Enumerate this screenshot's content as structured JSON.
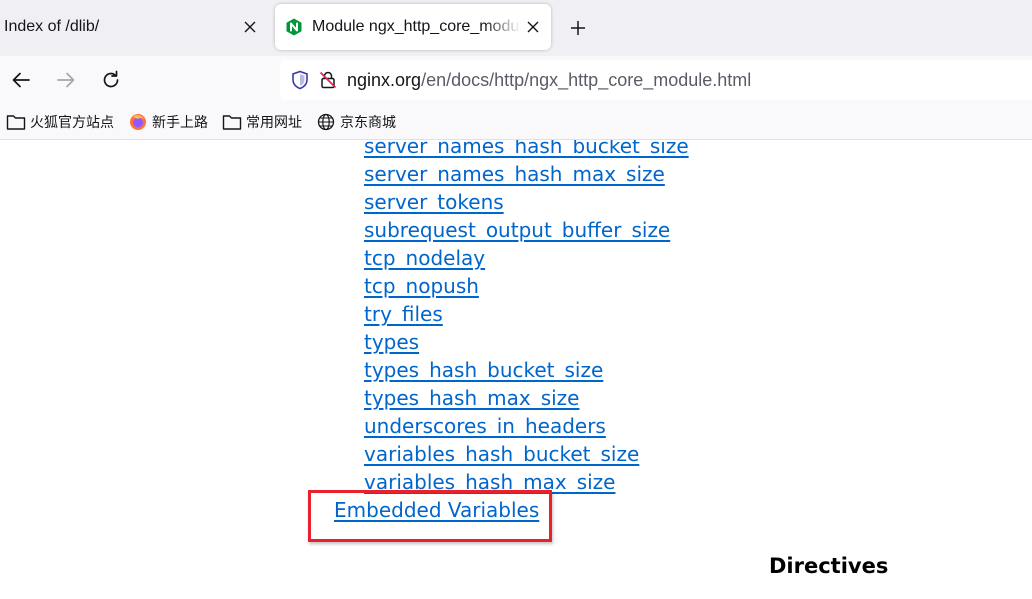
{
  "tabs": [
    {
      "title": "Index of /dlib/",
      "active": false
    },
    {
      "title": "Module ngx_http_core_module",
      "active": true,
      "favicon": "nginx-icon"
    }
  ],
  "nav": {
    "url_host": "nginx.org",
    "url_path": "/en/docs/http/ngx_http_core_module.html"
  },
  "bookmarks": [
    {
      "label": "火狐官方站点",
      "icon": "folder-icon"
    },
    {
      "label": "新手上路",
      "icon": "firefox-icon"
    },
    {
      "label": "常用网址",
      "icon": "folder-icon"
    },
    {
      "label": "京东商城",
      "icon": "globe-icon"
    }
  ],
  "content": {
    "directives": [
      "server_names_hash_bucket_size",
      "server_names_hash_max_size",
      "server_tokens",
      "subrequest_output_buffer_size",
      "tcp_nodelay",
      "tcp_nopush",
      "try_files",
      "types",
      "types_hash_bucket_size",
      "types_hash_max_size",
      "underscores_in_headers",
      "variables_hash_bucket_size",
      "variables_hash_max_size"
    ],
    "embedded_link": "Embedded Variables",
    "section_title": "Directives"
  },
  "colors": {
    "link": "#0066cc",
    "highlight_box": "#e8222c",
    "nginx_green": "#009639"
  }
}
